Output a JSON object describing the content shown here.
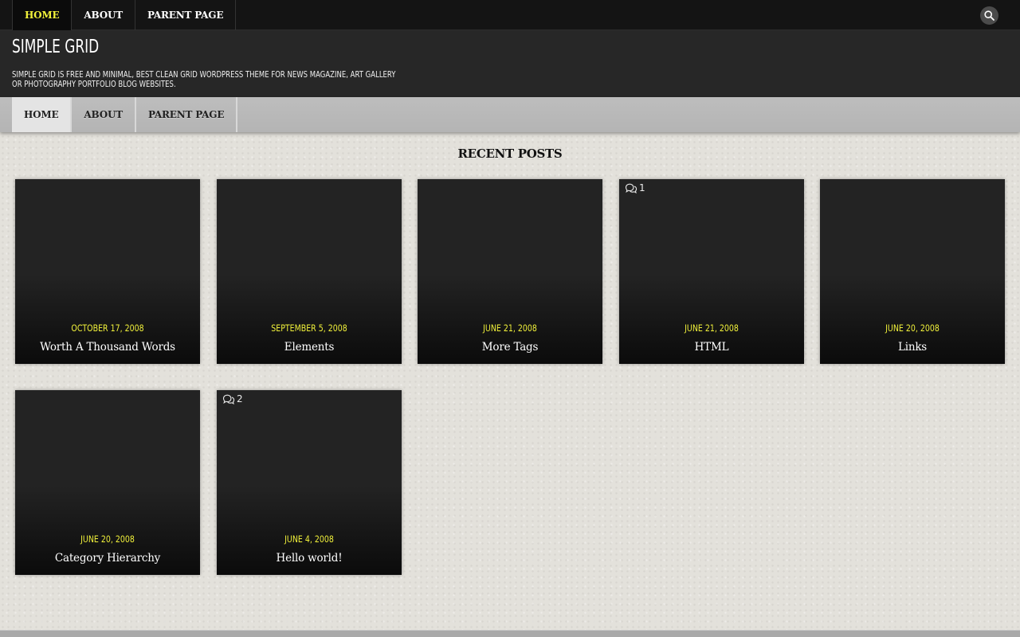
{
  "topnav": {
    "items": [
      {
        "label": "HOME"
      },
      {
        "label": "ABOUT"
      },
      {
        "label": "PARENT PAGE"
      }
    ]
  },
  "header": {
    "title": "SIMPLE GRID",
    "description_line1": "SIMPLE GRID IS FREE AND MINIMAL, BEST CLEAN GRID WORDPRESS THEME FOR NEWS MAGAZINE, ART GALLERY",
    "description_line2": "OR PHOTOGRAPHY PORTFOLIO BLOG WEBSITES."
  },
  "subnav": {
    "items": [
      {
        "label": "HOME"
      },
      {
        "label": "ABOUT"
      },
      {
        "label": "PARENT PAGE"
      }
    ]
  },
  "main": {
    "section_title": "RECENT POSTS",
    "posts": [
      {
        "date": "OCTOBER 17, 2008",
        "title": "Worth A Thousand Words",
        "comments": ""
      },
      {
        "date": "SEPTEMBER 5, 2008",
        "title": "Elements",
        "comments": ""
      },
      {
        "date": "JUNE 21, 2008",
        "title": "More Tags",
        "comments": ""
      },
      {
        "date": "JUNE 21, 2008",
        "title": "HTML",
        "comments": "1"
      },
      {
        "date": "JUNE 20, 2008",
        "title": "Links",
        "comments": ""
      },
      {
        "date": "JUNE 20, 2008",
        "title": "Category Hierarchy",
        "comments": ""
      },
      {
        "date": "JUNE 4, 2008",
        "title": "Hello world!",
        "comments": "2"
      }
    ]
  },
  "icons": {
    "search": "search-icon",
    "comments": "comment-bubbles-icon"
  },
  "colors": {
    "accent": "#f2f23a",
    "topbar": "#141414",
    "header": "#272727",
    "subnav": "#b8b8b8"
  }
}
